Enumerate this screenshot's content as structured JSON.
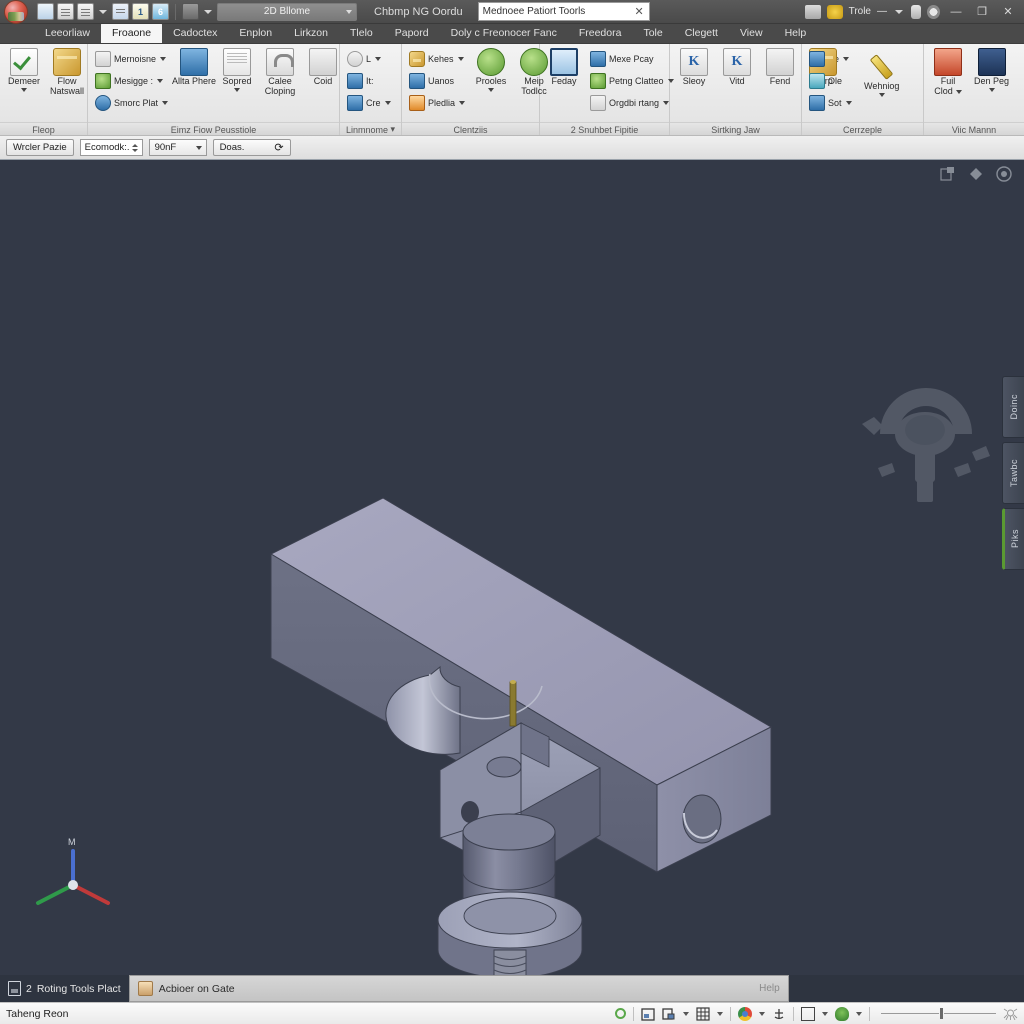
{
  "window": {
    "title": "Chbmp NG Oordu",
    "search_value": "Mednoee Patiort Toorls",
    "search_clear": "✕",
    "workspace": "2D Bllome",
    "trole_label": "Trole",
    "min": "—",
    "restore": "❐",
    "close": "✕"
  },
  "quick_access": {
    "app_button": "app-logo",
    "items": [
      {
        "name": "new-document",
        "glyph": ""
      },
      {
        "name": "save-document",
        "glyph": ""
      },
      {
        "name": "save-as-document",
        "glyph": ""
      },
      {
        "name": "qat-dropdown",
        "glyph": "▾"
      },
      {
        "name": "print-document",
        "glyph": ""
      },
      {
        "name": "number-tool",
        "glyph": "1"
      },
      {
        "name": "undo-history",
        "glyph": "6"
      },
      {
        "name": "workspace-icon",
        "glyph": ""
      },
      {
        "name": "workspace-dropdown",
        "glyph": "▾"
      }
    ]
  },
  "tabs": [
    {
      "label": "Leeorliaw",
      "active": false
    },
    {
      "label": "Froaone",
      "active": true
    },
    {
      "label": "Cadoctex",
      "active": false
    },
    {
      "label": "Enplon",
      "active": false
    },
    {
      "label": "Lirkzon",
      "active": false
    },
    {
      "label": "Tlelo",
      "active": false
    },
    {
      "label": "Papord",
      "active": false
    },
    {
      "label": "Doly c Freonocer Fanc",
      "active": false
    },
    {
      "label": "Freedora",
      "active": false
    },
    {
      "label": "Tole",
      "active": false
    },
    {
      "label": "Clegett",
      "active": false
    },
    {
      "label": "View",
      "active": false
    },
    {
      "label": "Help",
      "active": false
    }
  ],
  "ribbon_panels": [
    {
      "title": "Fleop",
      "buttons": [
        {
          "label": "Demeer",
          "label2": "",
          "icon": "check-icon",
          "dropdown": true
        },
        {
          "label": "Flow",
          "label2": "Natswall",
          "icon": "gold-block-icon",
          "dropdown": false
        }
      ],
      "small": []
    },
    {
      "title": "Eimz Fiow Peusstiole",
      "buttons": [
        {
          "label": "Allta Phere",
          "label2": "",
          "icon": "blue-monitor-icon",
          "dropdown": false
        },
        {
          "label": "Sopred",
          "label2": "",
          "icon": "green-plant-icon",
          "dropdown": true
        },
        {
          "label": "Calee",
          "label2": "Cloping",
          "icon": "frame-icon",
          "dropdown": false
        },
        {
          "label": "Coid",
          "label2": "",
          "icon": "clamp-icon",
          "dropdown": false
        }
      ],
      "small": [
        {
          "label": "Mernoisne",
          "icon": "hose-icon",
          "dropdown": true
        },
        {
          "label": "Mesigge :",
          "icon": "chart-icon",
          "dropdown": true
        },
        {
          "label": "Smorc Plat",
          "icon": "wave-icon",
          "dropdown": true
        }
      ]
    },
    {
      "title": "Linmnome",
      "buttons": [],
      "small": [
        {
          "label": "L",
          "icon": "circle-grey-icon",
          "dropdown": true
        },
        {
          "label": "It:",
          "icon": "blue-square-icon",
          "dropdown": false
        },
        {
          "label": "Cre",
          "icon": "page-blue-icon",
          "dropdown": true
        }
      ]
    },
    {
      "title": "Clentziis",
      "buttons": [
        {
          "label": "Prooles",
          "label2": "",
          "icon": "green-node-icon",
          "dropdown": true
        },
        {
          "label": "Meip",
          "label2": "Todlcc",
          "icon": "green-node2-icon",
          "dropdown": false
        }
      ],
      "small": [
        {
          "label": "Kehes",
          "icon": "key-icon",
          "dropdown": true
        },
        {
          "label": "Uanos",
          "icon": "folder-icon",
          "dropdown": false
        },
        {
          "label": "Pledlia",
          "icon": "table-icon",
          "dropdown": true
        }
      ]
    },
    {
      "title": "2 Snuhbet Fipitie",
      "buttons": [
        {
          "label": "Feday",
          "label2": "",
          "icon": "screen-icon",
          "dropdown": false
        }
      ],
      "small": [
        {
          "label": "Mexe Pcay",
          "icon": "blue-tile-icon",
          "dropdown": false
        },
        {
          "label": "Petng Clatteo",
          "icon": "green-tile-icon",
          "dropdown": true
        },
        {
          "label": "Orgdbi rtang",
          "icon": "grid-icon",
          "dropdown": true
        }
      ]
    },
    {
      "title": "Sirtking Jaw",
      "buttons": [
        {
          "label": "Sleoy",
          "label2": "",
          "icon": "k-arrow-icon",
          "dropdown": false
        },
        {
          "label": "Vitd",
          "label2": "",
          "icon": "k-arrow2-icon",
          "dropdown": false
        },
        {
          "label": "Fend",
          "label2": "",
          "icon": "grey-arrow-icon",
          "dropdown": false
        },
        {
          "label": "Corp",
          "label2": "",
          "icon": "gold-tool-icon",
          "dropdown": false
        }
      ],
      "small": []
    },
    {
      "title": "Cerrzeple",
      "buttons": [
        {
          "label": "Wehniog",
          "label2": "",
          "icon": "pencil-icon",
          "dropdown": true
        }
      ],
      "small": [
        {
          "label": "Se",
          "icon": "blue-page-icon",
          "dropdown": true
        },
        {
          "label": "Ole",
          "icon": "teal-page-icon",
          "dropdown": false
        },
        {
          "label": "Sot",
          "icon": "grid-blue-icon",
          "dropdown": true
        }
      ]
    },
    {
      "title": "Viic Mannn",
      "buttons": [
        {
          "label": "Fuil",
          "label2": "Clod",
          "icon": "red-tool-icon",
          "dropdown": true
        },
        {
          "label": "Den Peg",
          "label2": "",
          "icon": "dark-panel-icon",
          "dropdown": true
        }
      ],
      "small": []
    }
  ],
  "sub_toolbar": {
    "button1": "Wrcler Pazie",
    "field_label": "Ecomodk:.",
    "field_value": "",
    "select_value": "90nF",
    "button2": "Doas.",
    "refresh": "⟳"
  },
  "canvas": {
    "top_icons": [
      "export-icon",
      "tag-icon",
      "help-circle-icon"
    ],
    "side_tabs": [
      {
        "label": "Doinc",
        "accent": false
      },
      {
        "label": "Tawbc",
        "accent": false
      },
      {
        "label": "Piks",
        "accent": true
      }
    ],
    "axis_label": "M",
    "axis_colors": {
      "z": "#4a6fd0",
      "x": "#2f9a4a",
      "y": "#c03a3a"
    },
    "background": "#333947",
    "model_fill": "#9a9ab4",
    "model_fill_dark": "#5a5f73"
  },
  "browser_bar": {
    "panel_label": "Roting Tools Plact",
    "panel_prefix": "2",
    "tab_label": "Acbioer on Gate",
    "help_label": "Help"
  },
  "status_bar": {
    "message": "Taheng Reon",
    "items": [
      "frame-icon",
      "layer-icon",
      "grid-icon",
      "chrome-icon",
      "anchor-icon",
      "square-icon",
      "tree-icon"
    ]
  }
}
